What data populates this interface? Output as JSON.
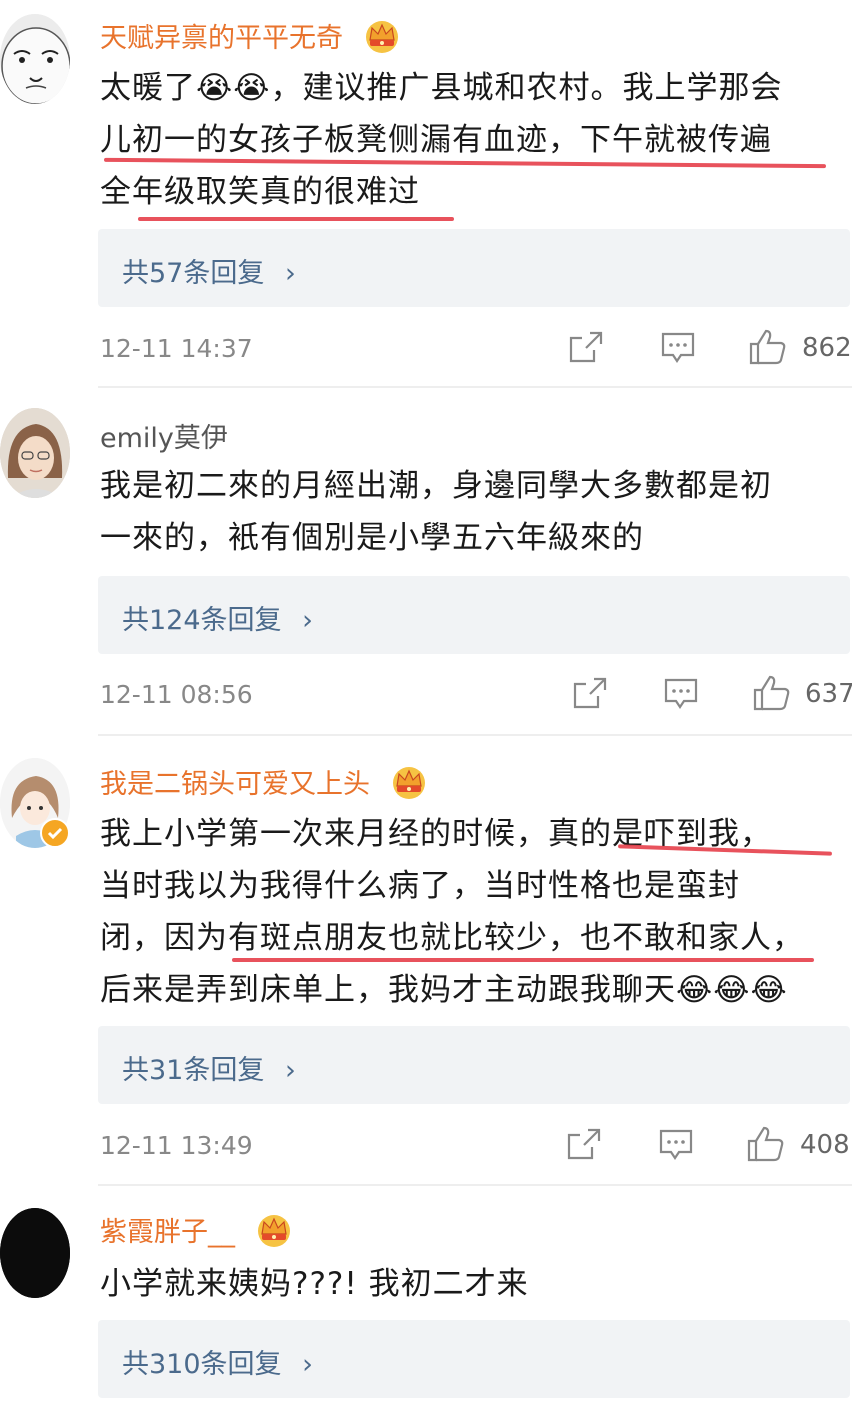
{
  "comments": [
    {
      "username": "天赋异禀的平平无奇",
      "lines": [
        "太暖了😭😭，建议推广县城和农村。我上学那会",
        "儿初一的女孩子板凳侧漏有血迹，下午就被传遍",
        "全年级取笑真的很难过"
      ],
      "reply_label": "共57条回复",
      "time": "12-11 14:37",
      "likes": "862"
    },
    {
      "username": "emily莫伊",
      "lines": [
        "我是初二來的月經出潮，身邊同學大多數都是初",
        "一來的，衹有個別是小學五六年級來的"
      ],
      "reply_label": "共124条回复",
      "time": "12-11 08:56",
      "likes": "637"
    },
    {
      "username": "我是二锅头可爱又上头",
      "lines": [
        "我上小学第一次来月经的时候，真的是吓到我，",
        "当时我以为我得什么病了，当时性格也是蛮封",
        "闭，因为有斑点朋友也就比较少，也不敢和家人，",
        "后来是弄到床单上，我妈才主动跟我聊天😂😂😂"
      ],
      "reply_label": "共31条回复",
      "time": "12-11 13:49",
      "likes": "408"
    },
    {
      "username": "紫霞胖子__",
      "lines": [
        "小学就来姨妈???! 我初二才来"
      ],
      "reply_label": "共310条回复"
    }
  ],
  "icons": {
    "share": "share-icon",
    "comment": "comment-icon",
    "like": "thumbs-up-icon",
    "crown": "crown-badge-icon",
    "verified": "verified-badge-icon",
    "chevron": "chevron-right-icon"
  },
  "colors": {
    "vip_name": "#e8732c",
    "reply_link": "#4b6a8c",
    "highlight": "#e63f4a",
    "verified": "#f5a623"
  }
}
